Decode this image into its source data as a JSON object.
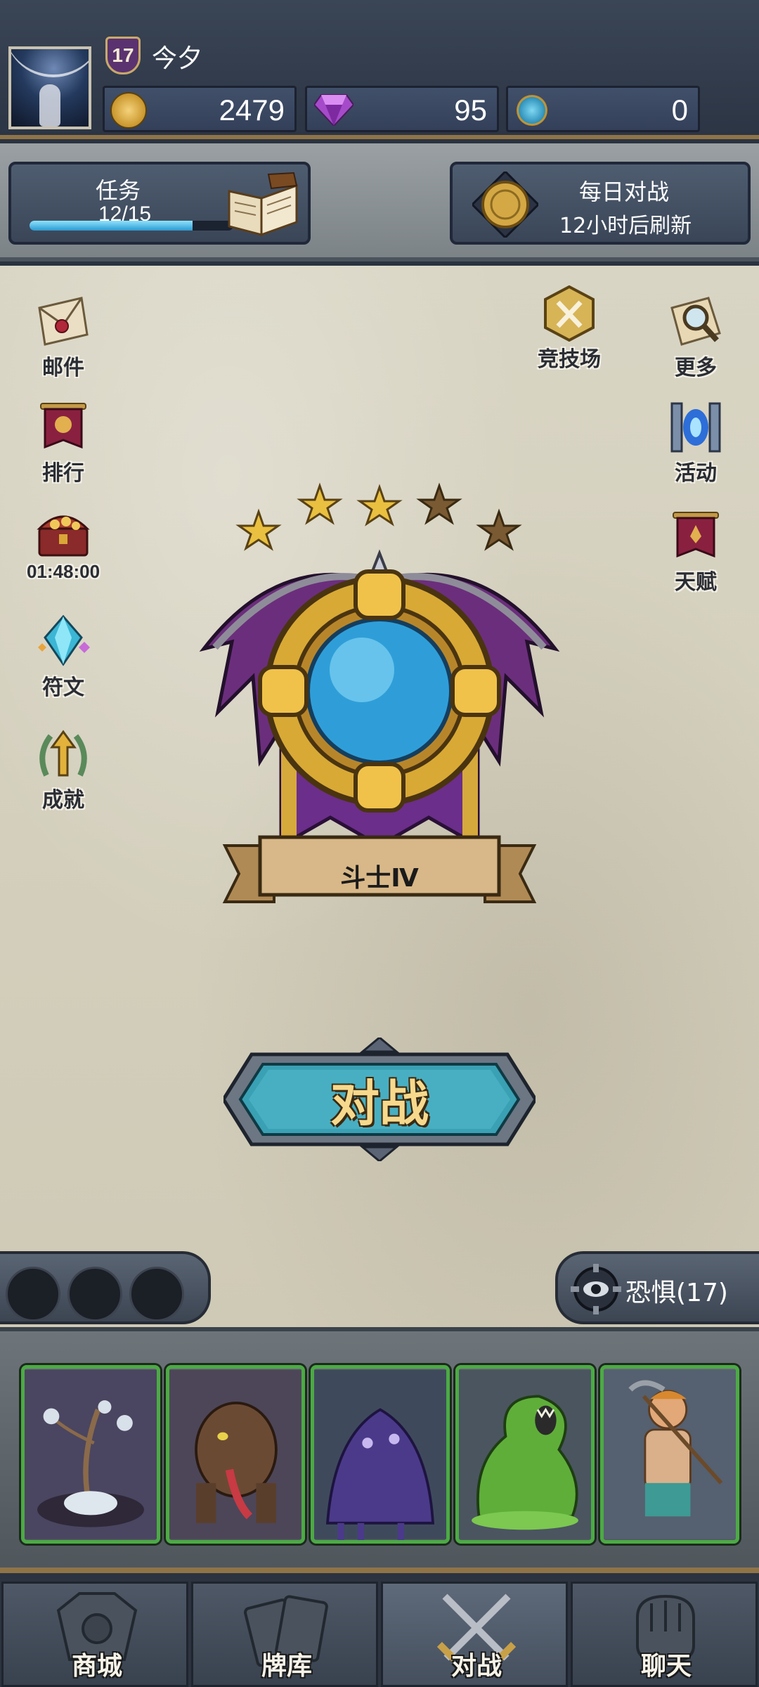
{
  "player": {
    "level": "17",
    "name": "今夕"
  },
  "resources": {
    "gold": "2479",
    "gems": "95",
    "crystals": "0"
  },
  "tasks": {
    "title": "任务",
    "progress_text": "12/15",
    "progress": 0.8
  },
  "daily_battle": {
    "title": "每日对战",
    "subtitle": "12小时后刷新"
  },
  "left_menu": [
    {
      "label": "邮件",
      "icon": "mail-icon"
    },
    {
      "label": "排行",
      "icon": "ranking-banner-icon"
    },
    {
      "label": "01:48:00",
      "icon": "treasure-chest-icon"
    },
    {
      "label": "符文",
      "icon": "rune-crystal-icon"
    },
    {
      "label": "成就",
      "icon": "achievement-laurel-icon"
    }
  ],
  "right_menu": [
    {
      "label": "竞技场",
      "icon": "arena-swords-icon"
    },
    {
      "label": "更多",
      "icon": "magnifier-scroll-icon"
    },
    {
      "label": "活动",
      "icon": "portal-icon"
    },
    {
      "label": "天赋",
      "icon": "talent-banner-icon"
    }
  ],
  "rank": {
    "title": "斗士Ⅳ",
    "stars_total": 5,
    "stars_filled": 3
  },
  "battle_button": {
    "label": "对战"
  },
  "fear": {
    "label": "恐惧(17)"
  },
  "deck_cards": [
    {
      "name": "thorn-flower-card",
      "icon": "flower-plant-icon"
    },
    {
      "name": "brute-beast-card",
      "icon": "tongue-beast-icon"
    },
    {
      "name": "shadow-ooze-card",
      "icon": "purple-ooze-icon"
    },
    {
      "name": "green-slime-card",
      "icon": "green-slime-icon"
    },
    {
      "name": "miner-hero-card",
      "icon": "pickaxe-miner-icon"
    }
  ],
  "nav": [
    {
      "label": "商城",
      "icon": "shop-icon",
      "active": false
    },
    {
      "label": "牌库",
      "icon": "card-deck-icon",
      "active": false
    },
    {
      "label": "对战",
      "icon": "crossed-swords-icon",
      "active": true
    },
    {
      "label": "聊天",
      "icon": "chat-fist-icon",
      "active": false
    }
  ],
  "colors": {
    "accent_gold": "#c9962d",
    "card_border": "#4caa45",
    "button_teal": "#3aa0b4",
    "parchment": "#d6d1bf"
  }
}
